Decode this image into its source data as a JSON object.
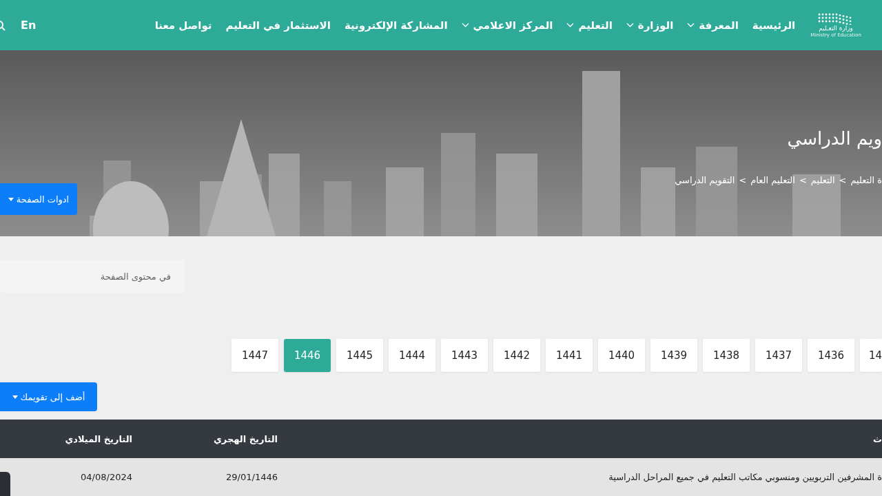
{
  "logo": {
    "title": "وزارة التعـليم",
    "subtitle": "Ministry of Education"
  },
  "nav": {
    "items": [
      {
        "label": "الرئيسية",
        "dropdown": false
      },
      {
        "label": "المعرفة",
        "dropdown": true
      },
      {
        "label": "الوزارة",
        "dropdown": true
      },
      {
        "label": "التعليم",
        "dropdown": true
      },
      {
        "label": "المركز الاعلامي",
        "dropdown": true
      },
      {
        "label": "المشاركة الإلكترونية",
        "dropdown": false
      },
      {
        "label": "الاستثمار في التعليم",
        "dropdown": false
      },
      {
        "label": "تواصل معنا",
        "dropdown": false
      }
    ],
    "language": "En"
  },
  "hero": {
    "title": "ويم الدراسي",
    "breadcrumb": [
      "ة التعليم",
      "التعليم",
      "التعليم العام",
      "التقويم الدراسي"
    ],
    "separator": ">",
    "tools_button": "ادوات الصفحة"
  },
  "search": {
    "placeholder": "في محتوى الصفحة"
  },
  "years": [
    {
      "label": "14",
      "selected": false
    },
    {
      "label": "1436",
      "selected": false
    },
    {
      "label": "1437",
      "selected": false
    },
    {
      "label": "1438",
      "selected": false
    },
    {
      "label": "1439",
      "selected": false
    },
    {
      "label": "1440",
      "selected": false
    },
    {
      "label": "1441",
      "selected": false
    },
    {
      "label": "1442",
      "selected": false
    },
    {
      "label": "1443",
      "selected": false
    },
    {
      "label": "1444",
      "selected": false
    },
    {
      "label": "1445",
      "selected": false
    },
    {
      "label": "1446",
      "selected": true
    },
    {
      "label": "1447",
      "selected": false
    }
  ],
  "add_button": "أضف إلى تقويمك",
  "table": {
    "columns": [
      "ث",
      "التاريخ الهجري",
      "التاريخ الميلادي"
    ],
    "rows": [
      [
        "ة المشرفين التربويين ومنسوبي مكاتب التعليم في جميع المراحل الدراسية",
        "29/01/1446",
        "04/08/2024"
      ]
    ]
  }
}
